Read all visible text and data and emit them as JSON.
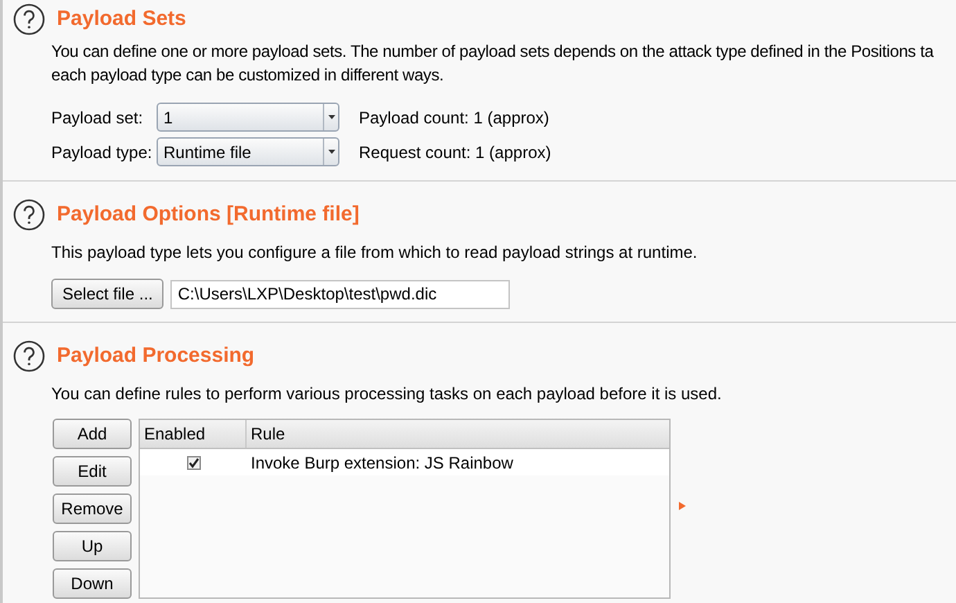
{
  "payload_sets": {
    "title": "Payload Sets",
    "description_lines": [
      "You can define one or more payload sets. The number of payload sets depends on the attack type defined in the Positions ta",
      "each payload type can be customized in different ways."
    ],
    "fields": [
      {
        "label": "Payload set:",
        "value": "1",
        "info": "Payload count: 1 (approx)"
      },
      {
        "label": "Payload type:",
        "value": "Runtime file",
        "info": "Request count: 1 (approx)"
      }
    ]
  },
  "payload_options": {
    "title": "Payload Options [Runtime file]",
    "description": "This payload type lets you configure a file from which to read payload strings at runtime.",
    "button": "Select file ...",
    "path": "C:\\Users\\LXP\\Desktop\\test\\pwd.dic"
  },
  "payload_processing": {
    "title": "Payload Processing",
    "description": "You can define rules to perform various processing tasks on each payload before it is used.",
    "buttons": [
      "Add",
      "Edit",
      "Remove",
      "Up",
      "Down"
    ],
    "table": {
      "columns": [
        "Enabled",
        "Rule"
      ],
      "rows": [
        {
          "enabled": true,
          "rule": "Invoke Burp extension: JS Rainbow"
        }
      ]
    }
  }
}
